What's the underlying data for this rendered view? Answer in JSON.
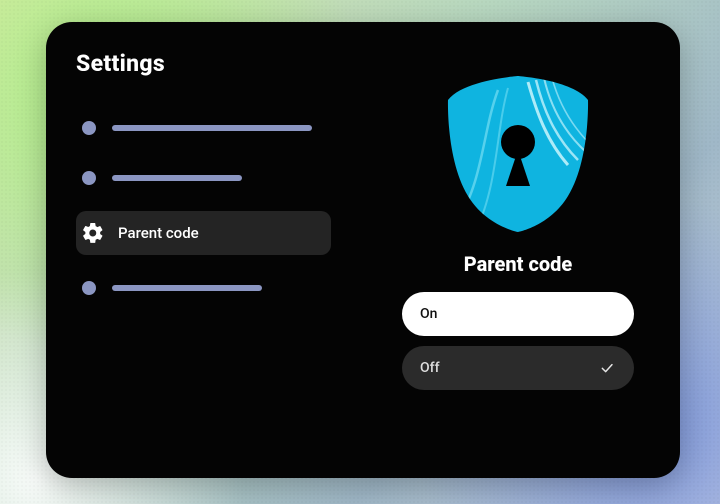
{
  "title": "Settings",
  "sidebar": {
    "items": [
      {
        "label": "Parent code"
      }
    ]
  },
  "detail": {
    "title": "Parent code",
    "options": {
      "on": "On",
      "off": "Off"
    },
    "selected": "off"
  },
  "colors": {
    "shield_main": "#0fb4e0",
    "shield_dark": "#0a7ea3",
    "placeholder": "#8b96c2"
  }
}
